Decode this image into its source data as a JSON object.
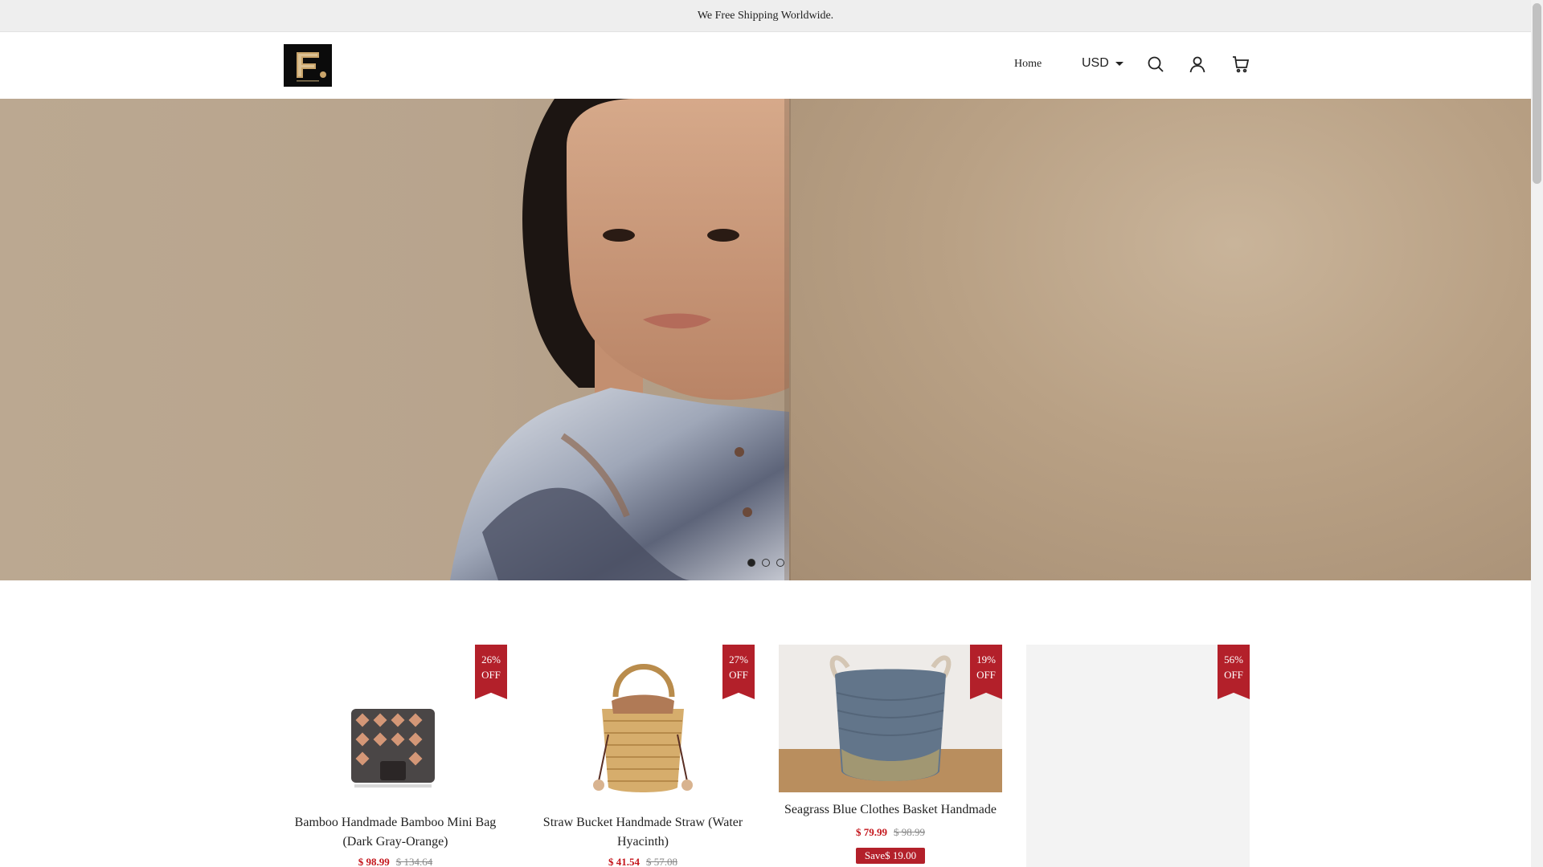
{
  "announcement": "We Free Shipping Worldwide.",
  "header": {
    "logo_letter": "F.",
    "nav": {
      "home": "Home"
    },
    "currency": "USD",
    "icons": {
      "search": "search-icon",
      "account": "user-icon",
      "cart": "cart-icon"
    }
  },
  "hero": {
    "slides": 3,
    "active_slide": 1,
    "image": "woman-in-printed-shirt-behind-wall"
  },
  "products": [
    {
      "badge_percent": "26%",
      "badge_off": "OFF",
      "title": "Bamboo Handmade Bamboo Mini Bag (Dark Gray-Orange)",
      "price": "$ 98.99",
      "compare": "$ 134.64"
    },
    {
      "badge_percent": "27%",
      "badge_off": "OFF",
      "title": "Straw Bucket Handmade Straw (Water Hyacinth)",
      "price": "$ 41.54",
      "compare": "$ 57.08"
    },
    {
      "badge_percent": "19%",
      "badge_off": "OFF",
      "title": "Seagrass Blue Clothes Basket Handmade",
      "price": "$ 79.99",
      "compare": "$ 98.99",
      "save": "Save$ 19.00"
    },
    {
      "badge_percent": "56%",
      "badge_off": "OFF",
      "title": "",
      "price": "",
      "compare": ""
    }
  ],
  "colors": {
    "accent": "#b3202a",
    "price": "#c4161c",
    "announcement_bg": "#eeeeee"
  }
}
